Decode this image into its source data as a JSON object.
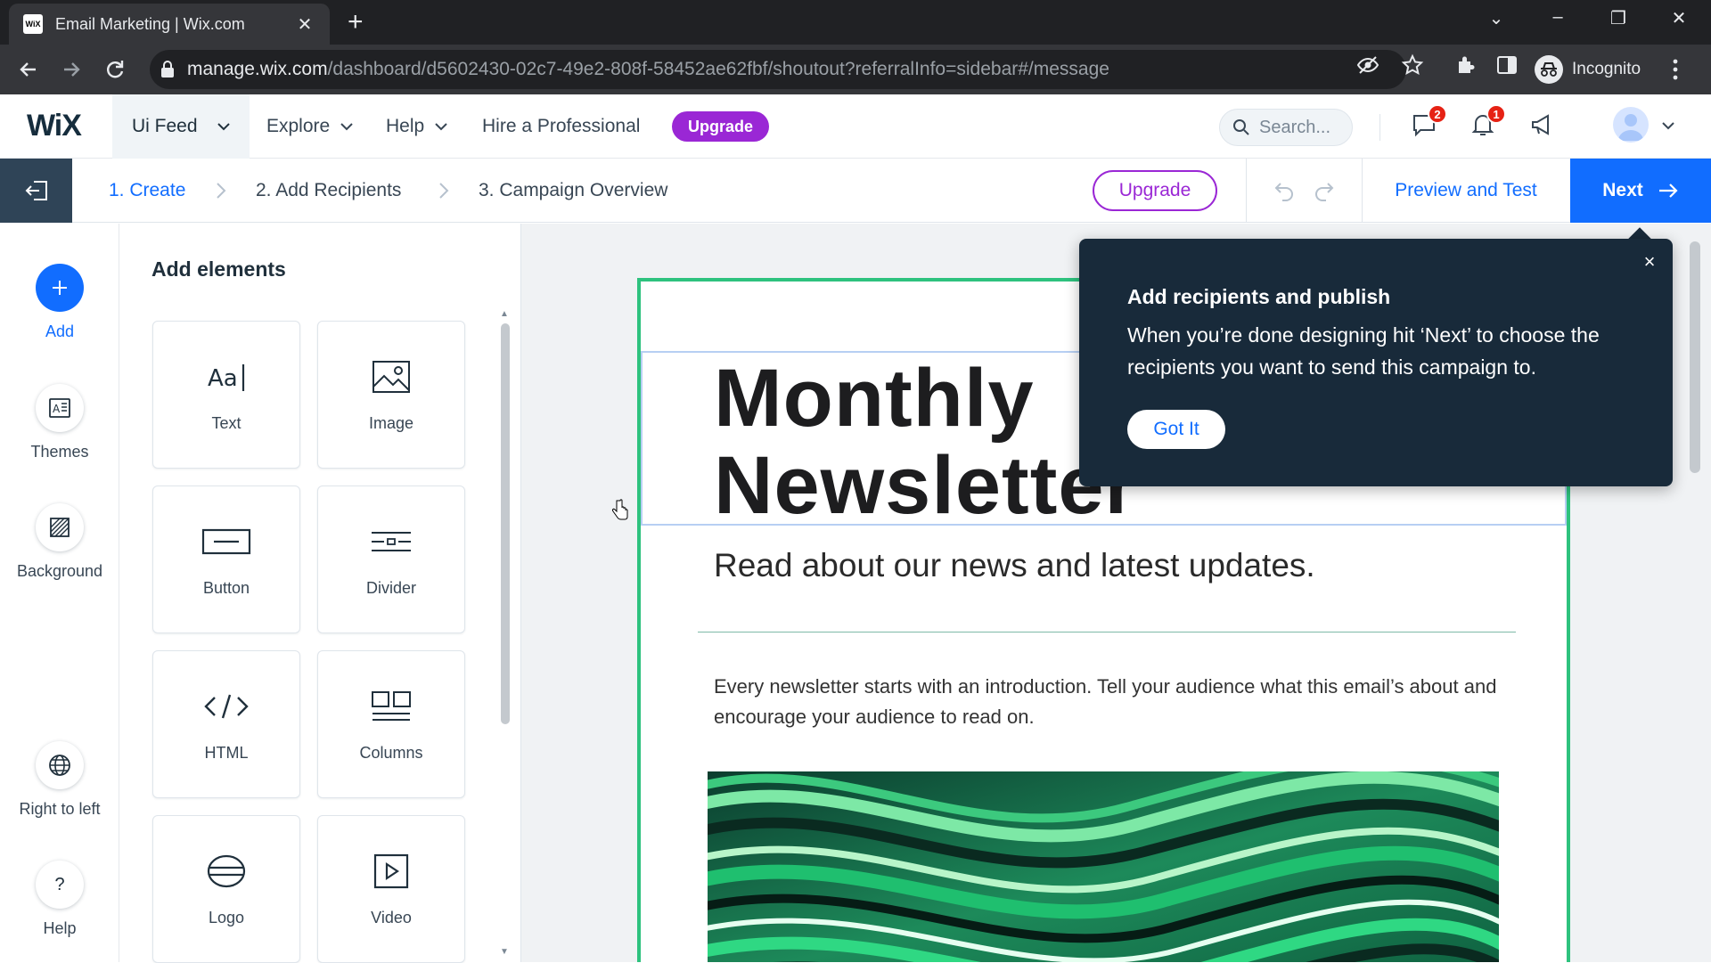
{
  "browser": {
    "tab_title": "Email Marketing | Wix.com",
    "favicon_text": "WiX",
    "url_host": "manage.wix.com",
    "url_path": "/dashboard/d5602430-02c7-49e2-808f-58452ae62fbf/shoutout?referralInfo=sidebar#/message",
    "profile_label": "Incognito"
  },
  "topnav": {
    "logo": "WiX",
    "site_name": "Ui Feed",
    "explore": "Explore",
    "help": "Help",
    "hire": "Hire a Professional",
    "upgrade": "Upgrade",
    "search_placeholder": "Search...",
    "messages_badge": "2",
    "notifications_badge": "1"
  },
  "editor": {
    "steps": [
      "1. Create",
      "2. Add Recipients",
      "3. Campaign Overview"
    ],
    "upgrade": "Upgrade",
    "preview": "Preview and Test",
    "next": "Next"
  },
  "rail": {
    "add": "Add",
    "themes": "Themes",
    "background": "Background",
    "rtl": "Right to left",
    "help": "Help"
  },
  "panel": {
    "title": "Add elements",
    "tiles": [
      "Text",
      "Image",
      "Button",
      "Divider",
      "HTML",
      "Columns",
      "Logo",
      "Video"
    ]
  },
  "email": {
    "title_line1": "Monthly",
    "title_line2": "Newsletter",
    "subtitle": "Read about our news and latest updates.",
    "body": "Every newsletter starts with an introduction. Tell your audience what this email’s about and encourage your audience to read on."
  },
  "tooltip": {
    "title": "Add recipients and publish",
    "body": "When you’re done designing hit ‘Next’ to choose the recipients you want to send this campaign to.",
    "button": "Got It"
  },
  "colors": {
    "accent": "#116dff",
    "upgrade": "#9a27d5",
    "frame": "#2ec27e",
    "tooltip_bg": "#182a3a"
  }
}
